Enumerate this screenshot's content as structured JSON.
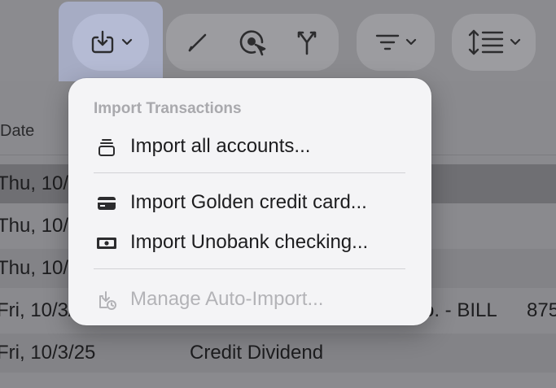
{
  "toolbar": {
    "import_button": {
      "icon": "import-icon",
      "chevron": "chevron-down-icon"
    },
    "edit_group": {
      "icons": [
        "pencil-icon",
        "review-icon",
        "split-icon"
      ]
    },
    "sort_button": {
      "icon": "filter-lines-icon",
      "chevron": "chevron-down-icon"
    },
    "density_button": {
      "icon": "row-height-icon",
      "chevron": "chevron-down-icon"
    }
  },
  "table": {
    "column_header": "Date",
    "rows": [
      {
        "date": "Thu, 10/",
        "description": "",
        "amount": ""
      },
      {
        "date": "Thu, 10/",
        "description": "",
        "amount": ""
      },
      {
        "date": "Thu, 10/",
        "description": "",
        "amount": ""
      },
      {
        "date": "Fri, 10/3/",
        "description": "o. - BILL",
        "amount": "875"
      },
      {
        "date": "Fri, 10/3/25",
        "description": "Credit Dividend",
        "amount": ""
      }
    ]
  },
  "menu": {
    "heading": "Import Transactions",
    "items": [
      {
        "label": "Import all accounts...",
        "icon": "stack-icon",
        "enabled": true
      },
      {
        "label": "Import Golden credit card...",
        "icon": "credit-card-icon",
        "enabled": true
      },
      {
        "label": "Import Unobank checking...",
        "icon": "banknote-icon",
        "enabled": true
      },
      {
        "label": "Manage Auto-Import...",
        "icon": "auto-import-icon",
        "enabled": false
      }
    ]
  },
  "colors": {
    "accent_highlight": "#a6acc4",
    "menu_background": "#f4f4f6",
    "disabled_text": "#b3b3b7"
  }
}
